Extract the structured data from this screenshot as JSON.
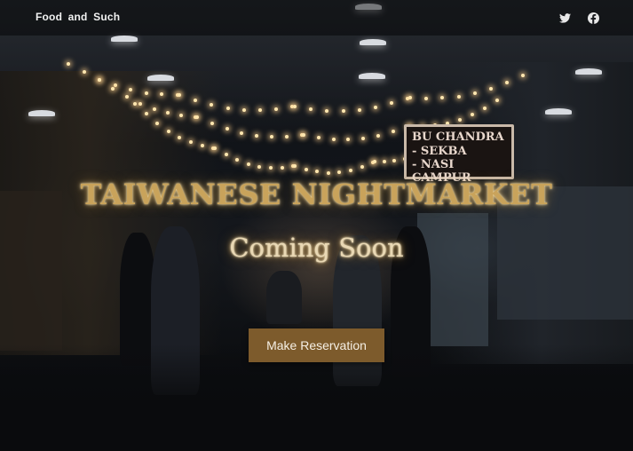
{
  "header": {
    "brand": "Food and Such",
    "social": [
      {
        "icon": "twitter-icon"
      },
      {
        "icon": "facebook-icon"
      }
    ]
  },
  "hero": {
    "title": "TAIWANESE NIGHTMARKET",
    "subtitle": "Coming Soon",
    "cta_label": "Make Reservation"
  },
  "background": {
    "sign_line1": "BU CHANDRA",
    "sign_line2": "- SEKBA",
    "sign_line3": "- NASI CAMPUR"
  },
  "colors": {
    "accent": "#7d5b2c",
    "title_gold": "#c9a35b"
  }
}
